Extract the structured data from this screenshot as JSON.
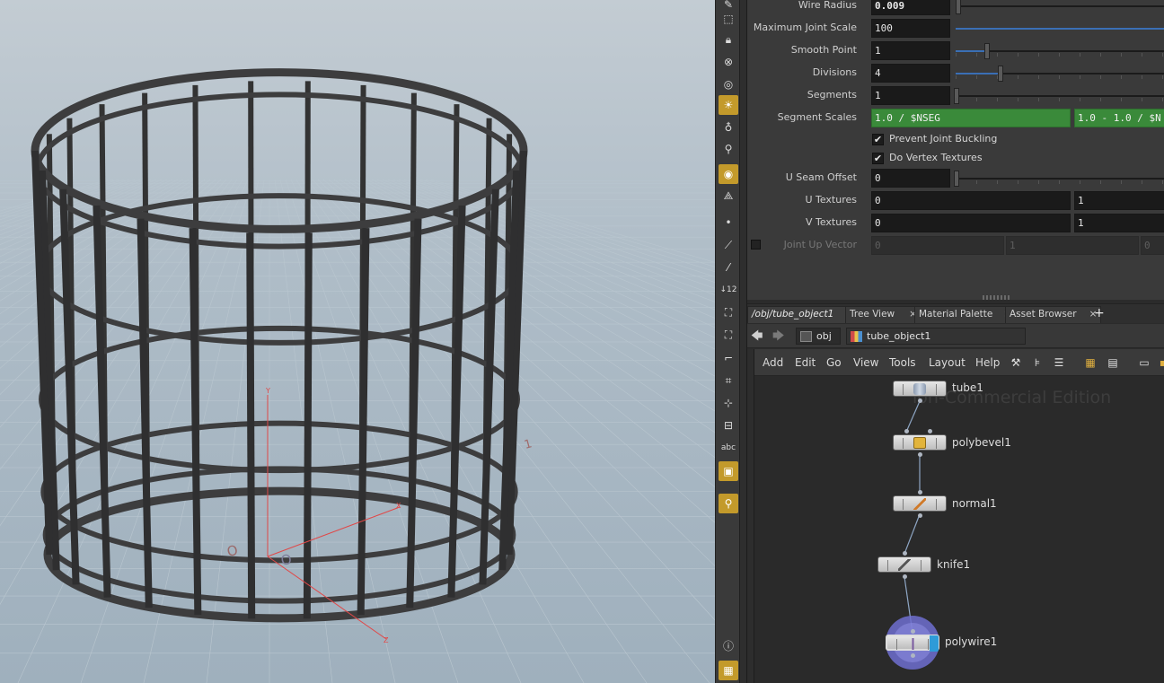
{
  "viewport": {
    "axis_label_x": "1",
    "axis_label_o": "O"
  },
  "shelf": {
    "tools": [
      "paint-icon",
      "select-icon",
      "lock-icon",
      "cancel-icon",
      "circle-icon",
      "light-icon",
      "bulb-icon",
      "light-add-icon",
      "camera-icon",
      "cone-icon",
      "point-icon",
      "pen-icon",
      "eyedropper-icon",
      "count-icon",
      "brush-icon",
      "brush-add-icon",
      "ruler-icon",
      "snap-icon",
      "pivot-icon",
      "handle-icon"
    ],
    "text_tool": "abc",
    "info_icon": "info-icon",
    "grid_icon": "grid-icon"
  },
  "params": {
    "wire_radius": {
      "label": "Wire Radius",
      "value": "0.009"
    },
    "max_joint_scale": {
      "label": "Maximum Joint Scale",
      "value": "100"
    },
    "smooth_point": {
      "label": "Smooth Point",
      "value": "1"
    },
    "divisions": {
      "label": "Divisions",
      "value": "4"
    },
    "segments": {
      "label": "Segments",
      "value": "1"
    },
    "segment_scales": {
      "label": "Segment Scales",
      "value1": "1.0 / $NSEG",
      "value2": "1.0 - 1.0 / $N"
    },
    "prevent_joint_buckling": {
      "label": "Prevent Joint Buckling",
      "checked": true,
      "mark": "✔"
    },
    "do_vertex_textures": {
      "label": "Do Vertex Textures",
      "checked": true,
      "mark": "✔"
    },
    "u_seam_offset": {
      "label": "U Seam Offset",
      "value": "0"
    },
    "u_textures": {
      "label": "U Textures",
      "value1": "0",
      "value2": "1"
    },
    "v_textures": {
      "label": "V Textures",
      "value1": "0",
      "value2": "1"
    },
    "joint_up_vector": {
      "label": "Joint Up Vector",
      "v1": "0",
      "v2": "1",
      "v3": "0"
    }
  },
  "tabs": [
    {
      "label": "/obj/tube_object1",
      "close": "×"
    },
    {
      "label": "Tree View",
      "close": "×"
    },
    {
      "label": "Material Palette",
      "close": "×"
    },
    {
      "label": "Asset Browser",
      "close": "×"
    }
  ],
  "tab_add": "+",
  "pathbar": {
    "back": "🡄",
    "forward": "🡆",
    "crumb1": "obj",
    "crumb2": "tube_object1"
  },
  "network_menu": [
    "Add",
    "Edit",
    "Go",
    "View",
    "Tools",
    "Layout",
    "Help"
  ],
  "network": {
    "watermark": "ion-Commercial Edition",
    "nodes": [
      {
        "name": "tube1"
      },
      {
        "name": "polybevel1"
      },
      {
        "name": "normal1"
      },
      {
        "name": "knife1"
      },
      {
        "name": "polywire1"
      }
    ]
  },
  "colors": {
    "accent_active": "#c39a2b",
    "expr_green": "#3a8a3a",
    "display_flag": "#2f9bd8",
    "template_ring": "#6f6fd0"
  }
}
